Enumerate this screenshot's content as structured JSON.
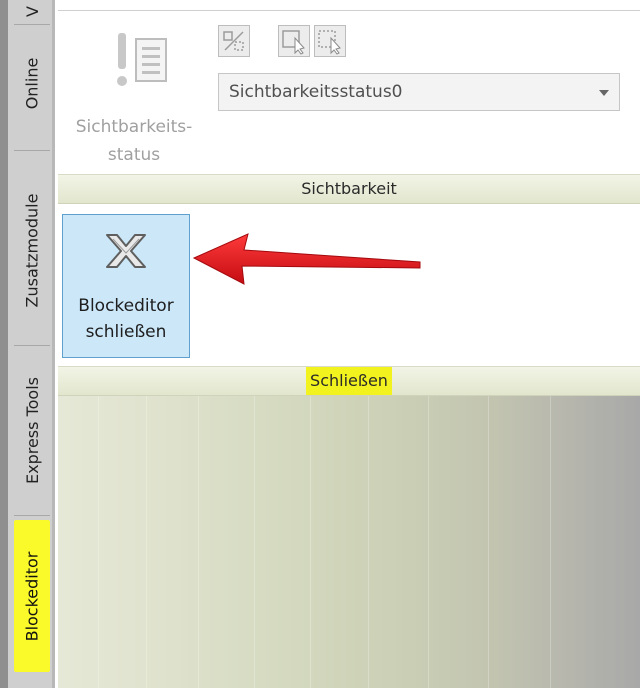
{
  "sidebar": {
    "tabs": [
      {
        "label": "V"
      },
      {
        "label": "Online"
      },
      {
        "label": "Zusatzmodule"
      },
      {
        "label": "Express Tools"
      },
      {
        "label": "Blockeditor",
        "active": true
      }
    ]
  },
  "ribbon": {
    "visibility_panel": {
      "button_label_line1": "Sichtbarkeits-",
      "button_label_line2": "status",
      "dropdown_value": "Sichtbarkeitsstatus0",
      "title": "Sichtbarkeit"
    },
    "close_panel": {
      "button_label_line1": "Blockeditor",
      "button_label_line2": "schließen",
      "title": "Schließen"
    }
  },
  "colors": {
    "highlight": "#f2f21e",
    "arrow": "#e8141b",
    "active_button_bg": "#cbe7f8"
  }
}
